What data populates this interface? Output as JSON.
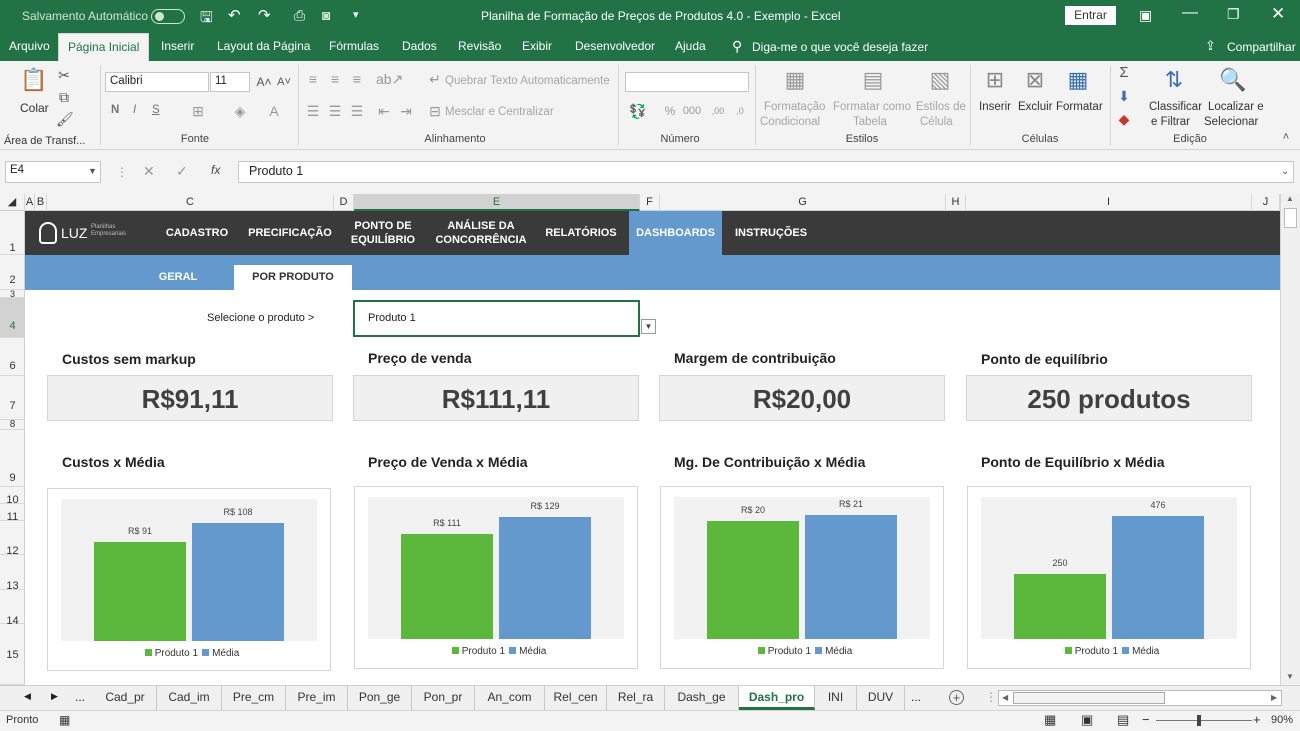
{
  "titlebar": {
    "autosave_label": "Salvamento Automático",
    "title": "Planilha de Formação de Preços de Produtos 4.0 - Exemplo  -  Excel",
    "signin_label": "Entrar"
  },
  "menu": {
    "items": [
      "Arquivo",
      "Página Inicial",
      "Inserir",
      "Layout da Página",
      "Fórmulas",
      "Dados",
      "Revisão",
      "Exibir",
      "Desenvolvedor",
      "Ajuda"
    ],
    "active": "Página Inicial",
    "search_label": "Diga-me o que você deseja fazer",
    "share_label": "Compartilhar"
  },
  "ribbon": {
    "paste_label": "Colar",
    "clipboard_label": "Área de Transf...",
    "font_name": "Calibri",
    "font_size": "11",
    "bold": "N",
    "italic": "I",
    "underline": "S",
    "font_label": "Fonte",
    "wrap_label": "Quebrar Texto Automaticamente",
    "merge_label": "Mesclar e Centralizar",
    "alignment_label": "Alinhamento",
    "number_label": "Número",
    "cond_format_l1": "Formatação",
    "cond_format_l2": "Condicional",
    "format_table_l1": "Formatar como",
    "format_table_l2": "Tabela",
    "cell_styles_l1": "Estilos de",
    "cell_styles_l2": "Célula",
    "styles_label": "Estilos",
    "insert_label": "Inserir",
    "delete_label": "Excluir",
    "format_label": "Formatar",
    "cells_label": "Células",
    "sort_l1": "Classificar",
    "sort_l2": "e Filtrar",
    "find_l1": "Localizar e",
    "find_l2": "Selecionar",
    "editing_label": "Edição"
  },
  "formula_bar": {
    "name_box": "E4",
    "fx": "fx",
    "value": "Produto 1"
  },
  "columns": [
    "A",
    "B",
    "C",
    "D",
    "E",
    "F",
    "G",
    "H",
    "I",
    "J"
  ],
  "selected_column": "E",
  "rows": [
    "1",
    "2",
    "3",
    "4",
    "6",
    "7",
    "8",
    "9",
    "10",
    "11",
    "12",
    "13",
    "14",
    "15"
  ],
  "selected_row": "4",
  "nav": {
    "items": [
      "CADASTRO",
      "PRECIFICAÇÃO",
      "PONTO DE EQUILÍBRIO",
      "ANÁLISE DA CONCORRÊNCIA",
      "RELATÓRIOS",
      "DASHBOARDS",
      "INSTRUÇÕES"
    ],
    "active": "DASHBOARDS",
    "logo_text": "LUZ",
    "logo_sub1": "Planilhas",
    "logo_sub2": "Empresariais"
  },
  "subnav": {
    "items": [
      "GERAL",
      "POR PRODUTO"
    ],
    "active": "POR PRODUTO"
  },
  "selector": {
    "label": "Selecione o produto >",
    "value": "Produto 1"
  },
  "kpis": [
    {
      "title": "Custos sem markup",
      "value": "R$91,11"
    },
    {
      "title": "Preço de venda",
      "value": "R$111,11"
    },
    {
      "title": "Margem de contribuição",
      "value": "R$20,00"
    },
    {
      "title": "Ponto de equilíbrio",
      "value": "250 produtos"
    }
  ],
  "chart_data": [
    {
      "type": "bar",
      "title": "Custos x Média",
      "categories": [
        "Produto 1",
        "Média"
      ],
      "values": [
        91,
        108
      ],
      "labels": [
        "R$ 91",
        "R$ 108"
      ],
      "ylim": [
        0,
        130
      ],
      "legend": "bottom",
      "grid": false,
      "colors": [
        "#5cb73d",
        "#6399cd"
      ]
    },
    {
      "type": "bar",
      "title": "Preço de Venda x Média",
      "categories": [
        "Produto 1",
        "Média"
      ],
      "values": [
        111,
        129
      ],
      "labels": [
        "R$ 111",
        "R$ 129"
      ],
      "ylim": [
        0,
        150
      ],
      "legend": "bottom",
      "grid": false,
      "colors": [
        "#5cb73d",
        "#6399cd"
      ]
    },
    {
      "type": "bar",
      "title": "Mg. De Contribuição x Média",
      "categories": [
        "Produto 1",
        "Média"
      ],
      "values": [
        20,
        21
      ],
      "labels": [
        "R$ 20",
        "R$ 21"
      ],
      "ylim": [
        0,
        24
      ],
      "legend": "bottom",
      "grid": false,
      "colors": [
        "#5cb73d",
        "#6399cd"
      ]
    },
    {
      "type": "bar",
      "title": "Ponto de Equilíbrio x Média",
      "categories": [
        "Produto 1",
        "Média"
      ],
      "values": [
        250,
        476
      ],
      "labels": [
        "250",
        "476"
      ],
      "ylim": [
        0,
        550
      ],
      "legend": "bottom",
      "grid": false,
      "colors": [
        "#5cb73d",
        "#6399cd"
      ]
    }
  ],
  "sheet_tabs": {
    "ellipsis": "...",
    "items": [
      "Cad_pr",
      "Cad_im",
      "Pre_cm",
      "Pre_im",
      "Pon_ge",
      "Pon_pr",
      "An_com",
      "Rel_cen",
      "Rel_ra",
      "Dash_ge",
      "Dash_pro",
      "INI",
      "DUV"
    ],
    "active": "Dash_pro",
    "more": "..."
  },
  "status": {
    "ready": "Pronto",
    "zoom": "90%"
  }
}
